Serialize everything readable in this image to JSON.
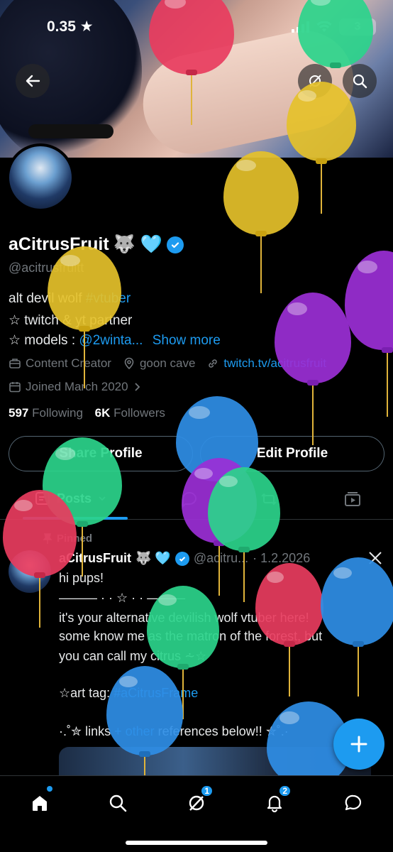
{
  "status_bar": {
    "time": "0.35",
    "battery": "3"
  },
  "profile": {
    "display_name": "aCitrusFruit",
    "name_emojis": "🐺 🩵",
    "handle": "@acitrusfruitt",
    "bio_line1_prefix": "alt devil wolf ",
    "bio_line1_tag": "#vtuber",
    "bio_line2": "☆ twitch & yt partner",
    "bio_line3_prefix": "☆ models : ",
    "bio_line3_link": "@2winta...",
    "show_more": "Show more",
    "category": "Content Creator",
    "location": "goon cave",
    "website": "twitch.tv/acitrusfruit",
    "joined": "Joined March 2020",
    "following_count": "597",
    "following_label": "Following",
    "followers_count": "6K",
    "followers_label": "Followers"
  },
  "actions": {
    "share": "Share Profile",
    "edit": "Edit Profile"
  },
  "tabs": {
    "posts": "Posts"
  },
  "post": {
    "pinned_label": "Pinned",
    "author": "aCitrusFruit",
    "author_emojis": "🐺 🩵",
    "handle_trunc": "@acitru...",
    "date": "· 1.2.2026",
    "line1": "hi pups!",
    "line2": "——— · · ☆ · · ———",
    "line3": "it's your alternative devilish wolf vtuber here!",
    "line4": "some know me as the matron of the forest, but",
    "line5": "you can call my citrus ⩪☆",
    "line6_prefix": "☆art tag: ",
    "line6_tag": "#aCitrusFrame",
    "line7_prefix": "·.˚✮ links ",
    "line7_link": "+ other",
    "line7_suffix": " references below!! ✮˚.·"
  },
  "nav": {
    "messages_badge": "1",
    "notifications_badge": "2"
  },
  "colors": {
    "accent": "#1d9bf0",
    "background": "#000000",
    "text": "#e7e9ea",
    "muted": "#71767b"
  }
}
